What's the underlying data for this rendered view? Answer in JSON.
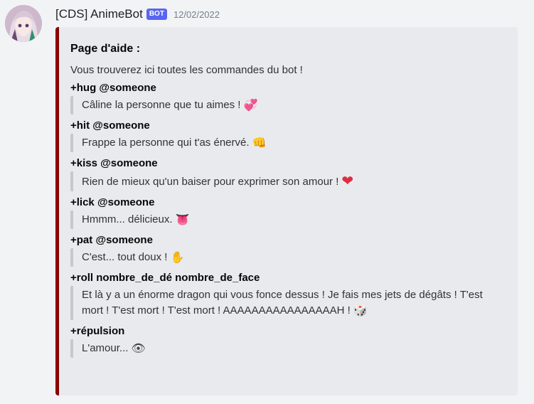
{
  "author": {
    "name": "[CDS] AnimeBot",
    "badge": "BOT",
    "timestamp": "12/02/2022"
  },
  "embed": {
    "color": "#8b0000",
    "title": "Page d'aide :",
    "description": "Vous trouverez ici toutes les commandes du bot !",
    "fields": [
      {
        "command": "+hug",
        "arg": "@someone",
        "value": "Câline la personne que tu aimes !",
        "emoji": "💞"
      },
      {
        "command": "+hit",
        "arg": "@someone",
        "value": "Frappe la personne qui t'as énervé.",
        "emoji": "👊"
      },
      {
        "command": "+kiss",
        "arg": "@someone",
        "value": "Rien de mieux qu'un baiser pour exprimer son amour !",
        "emoji": "❤"
      },
      {
        "command": "+lick",
        "arg": "@someone",
        "value": "Hmmm... délicieux.",
        "emoji": "👅"
      },
      {
        "command": "+pat",
        "arg": "@someone",
        "value": "C'est... tout doux !",
        "emoji": "✋"
      },
      {
        "command": "+roll nombre_de_dé nombre_de_face",
        "arg": "",
        "value": "Et là y a un énorme dragon qui vous fonce dessus ! Je fais mes jets de dégâts ! T'est mort ! T'est mort ! T'est mort ! AAAAAAAAAAAAAAAAH !",
        "emoji": "🎲"
      },
      {
        "command": "+répulsion",
        "arg": "",
        "value": "L'amour...",
        "emoji": "👁"
      }
    ]
  },
  "icons": {
    "avatar": "anime-girl-avatar"
  }
}
